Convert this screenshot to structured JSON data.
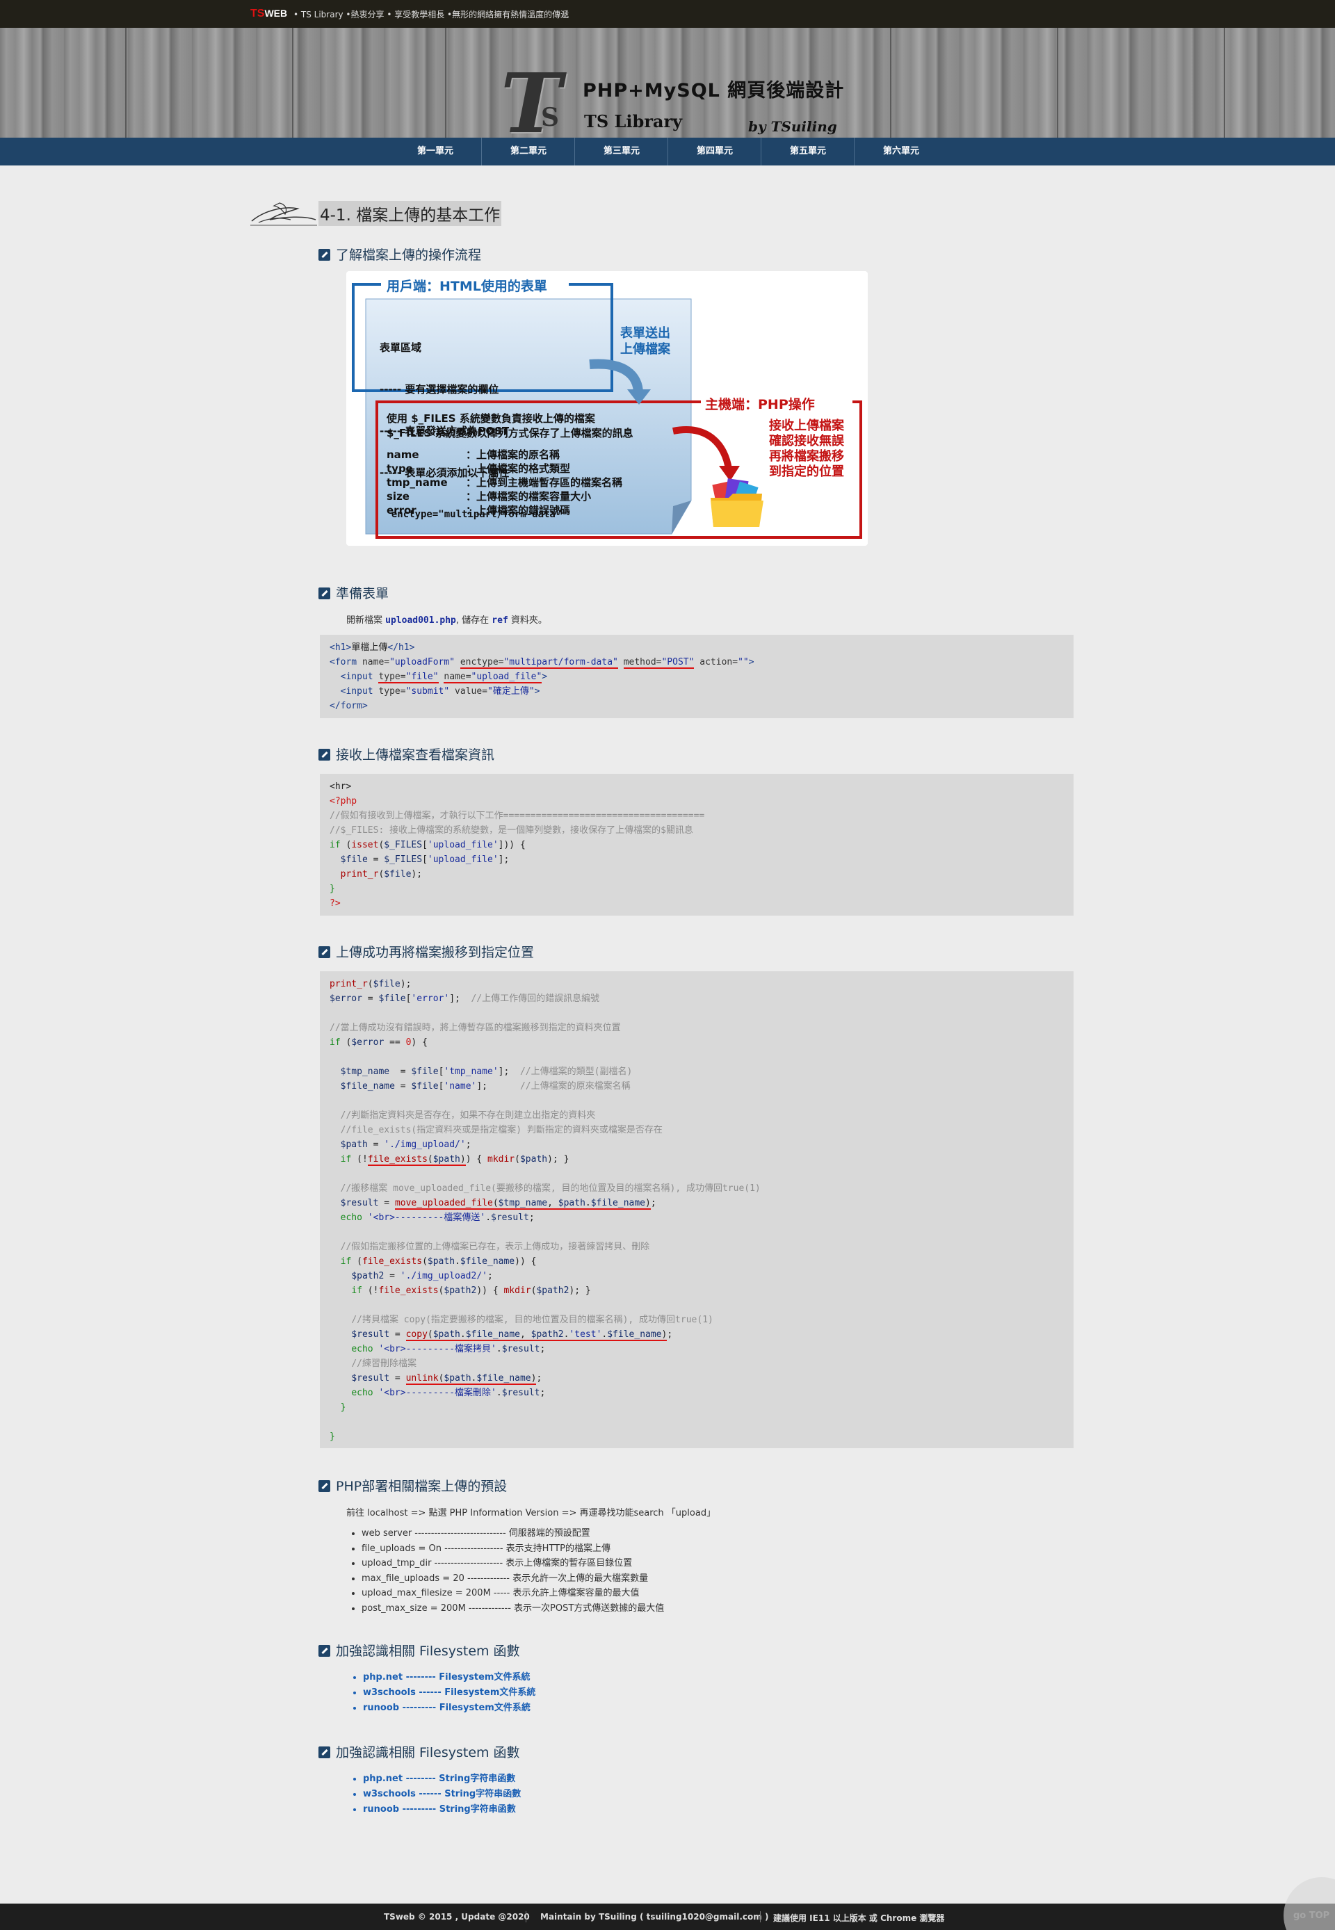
{
  "topbar": {
    "logo_ts": "TS",
    "logo_web": "WEB",
    "tagline": "• TS Library •熱衷分享 • 享受教學相長 •無形的網絡擁有熱情溫度的傳遞"
  },
  "header": {
    "title_main": "PHP+MySQL 網頁後端設計",
    "title_sub": "TS Library",
    "byline": "by TSuiling"
  },
  "nav": [
    "第一單元",
    "第二單元",
    "第三單元",
    "第四單元",
    "第五單元",
    "第六單元"
  ],
  "page": {
    "title": "4-1. 檔案上傳的基本工作"
  },
  "sections": {
    "s1": "了解檔案上傳的操作流程",
    "s2": "準備表單",
    "s3": "接收上傳檔案查看檔案資訊",
    "s4": "上傳成功再將檔案搬移到指定位置",
    "s5": "PHP部署相關檔案上傳的預設",
    "s6": "加強認識相關 Filesystem 函數",
    "s7": "加強認識相關 Filesystem 函數"
  },
  "diagram": {
    "client_title": "用戶端：HTML使用的表單",
    "client_lines": [
      "表單區域",
      "----- 要有選擇檔案的欄位",
      "----- 表單發送方式為POST",
      "----- 表單必須添加以下屬性",
      "  enctype=\"multipart/form-data\""
    ],
    "send_label_1": "表單送出",
    "send_label_2": "上傳檔案",
    "server_title": "主機端：PHP操作",
    "server_intro_1": "使用 $_FILES 系統變數負責接收上傳的檔案",
    "server_intro_2": "$_FILES 系統變數以陣列方式保存了上傳檔案的訊息",
    "fields": [
      {
        "k": "name",
        "v": "：上傳檔案的原名稱"
      },
      {
        "k": "type",
        "v": "：上傳檔案的格式類型"
      },
      {
        "k": "tmp_name",
        "v": "：上傳到主機端暫存區的檔案名稱"
      },
      {
        "k": "size",
        "v": "：上傳檔案的檔案容量大小"
      },
      {
        "k": "error",
        "v": "：上傳檔案的錯誤號碼"
      }
    ],
    "server_note": [
      "接收上傳檔案",
      "確認接收無誤",
      "再將檔案搬移",
      "到指定的位置"
    ]
  },
  "prepare_form": {
    "text_pre": "開新檔案 ",
    "file": "upload001.php",
    "text_mid": ", 儲存在 ",
    "folder": "ref",
    "text_post": " 資料夾。"
  },
  "deploy": {
    "intro": "前往 localhost => 點選 PHP Information Version => 再運尋找功能search 「upload」",
    "items": [
      "web server ---------------------------- 伺服器端的預設配置",
      "file_uploads = On ------------------ 表示支持HTTP的檔案上傳",
      "upload_tmp_dir --------------------- 表示上傳檔案的暫存區目錄位置",
      "max_file_uploads = 20 ------------- 表示允許一次上傳的最大檔案數量",
      "upload_max_filesize = 200M ----- 表示允許上傳檔案容量的最大值",
      "post_max_size = 200M ------------- 表示一次POST方式傳送數據的最大值"
    ]
  },
  "filesystem_links": [
    "php.net -------- Filesystem文件系統",
    "w3schools ------ Filesystem文件系統",
    "runoob --------- Filesystem文件系統"
  ],
  "string_links": [
    "php.net -------- String字符串函數",
    "w3schools ------ String字符串函數",
    "runoob --------- String字符串函數"
  ],
  "footer": {
    "copy": "TSweb © 2015 , Update @2020",
    "maintain": "Maintain by TSuiling ( tsuiling1020@gmail.com )",
    "advice": "建議使用 IE11 以上版本 或 Chrome 瀏覽器"
  },
  "gotop": "go TOP",
  "colors": {
    "nav_bg": "#1f4468",
    "topbar_bg": "#222018",
    "code_bg": "#d9d9d9",
    "accent_red": "#d11111",
    "link_blue": "#1a5fb4"
  }
}
